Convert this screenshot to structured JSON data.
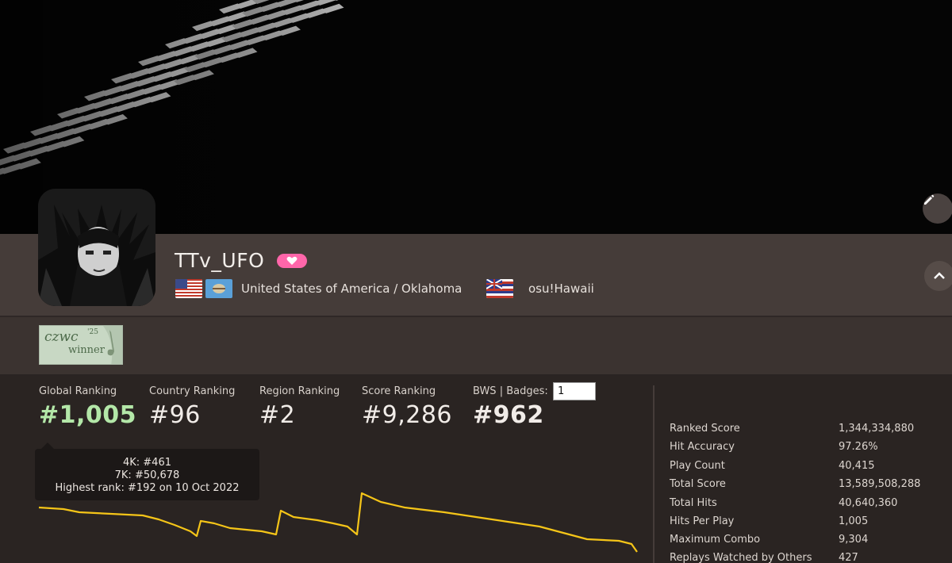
{
  "profile": {
    "username": "TTv_UFO",
    "country": "United States of America / Oklahoma",
    "team": "osu!Hawaii"
  },
  "badge": {
    "text_main": "czwc",
    "text_year": "'25",
    "text_sub": "winner"
  },
  "rankings": [
    {
      "label": "Global Ranking",
      "value": "#1,005"
    },
    {
      "label": "Country Ranking",
      "value": "#96"
    },
    {
      "label": "Region Ranking",
      "value": "#2"
    },
    {
      "label": "Score Ranking",
      "value": "#9,286"
    },
    {
      "label": "BWS | Badges:",
      "value": "#962"
    }
  ],
  "bws_badges_input": "1",
  "tooltip": {
    "line1": "4K: #461",
    "line2": "7K: #50,678",
    "line3": "Highest rank: #192 on 10 Oct 2022"
  },
  "stats": [
    {
      "label": "Ranked Score",
      "value": "1,344,334,880"
    },
    {
      "label": "Hit Accuracy",
      "value": "97.26%"
    },
    {
      "label": "Play Count",
      "value": "40,415"
    },
    {
      "label": "Total Score",
      "value": "13,589,508,288"
    },
    {
      "label": "Total Hits",
      "value": "40,640,360"
    },
    {
      "label": "Hits Per Play",
      "value": "1,005"
    },
    {
      "label": "Maximum Combo",
      "value": "9,304"
    },
    {
      "label": "Replays Watched by Others",
      "value": "427"
    }
  ],
  "colors": {
    "global_rank": "#b3e7a8",
    "graph_line": "#f5c518",
    "supporter": "#ff66aa"
  },
  "icons": {
    "edit": "pencil-icon",
    "collapse": "chevron-up-icon",
    "supporter": "heart-icon"
  }
}
